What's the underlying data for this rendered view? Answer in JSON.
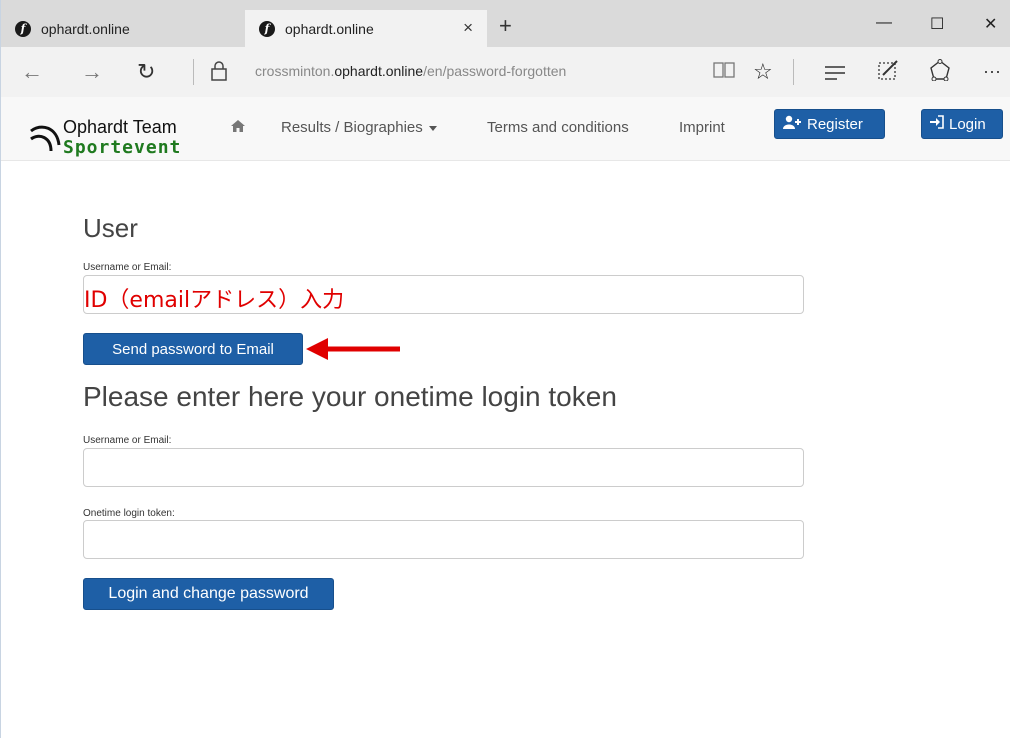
{
  "browser": {
    "tabs": [
      {
        "title": "ophardt.online"
      },
      {
        "title": "ophardt.online"
      }
    ],
    "new_tab": "+",
    "close_tab": "×",
    "window_buttons": {
      "minimize": "—",
      "maximize": "☐",
      "close": "✕"
    },
    "url_prefix": "crossminton.",
    "url_domain": "ophardt.online",
    "url_path": "/en/password-forgotten",
    "more": "···"
  },
  "site": {
    "logo_team": "Ophardt Team",
    "logo_sport": "Sportevent",
    "nav": {
      "results": "Results / Biographies",
      "terms": "Terms and conditions",
      "imprint": "Imprint",
      "register": "Register",
      "login": "Login"
    }
  },
  "user_section": {
    "heading": "User",
    "username_label": "Username or Email:",
    "username_value": "ID（emailアドレス）入力",
    "send_button": "Send password to Email"
  },
  "token_section": {
    "heading": "Please enter here your onetime login token",
    "username_label": "Username or Email:",
    "username_value": "",
    "token_label": "Onetime login token:",
    "token_value": "",
    "login_button": "Login and change password"
  },
  "colors": {
    "primary": "#1e5fa6",
    "annotation_red": "#e00000",
    "logo_green": "#1f7a1f"
  }
}
